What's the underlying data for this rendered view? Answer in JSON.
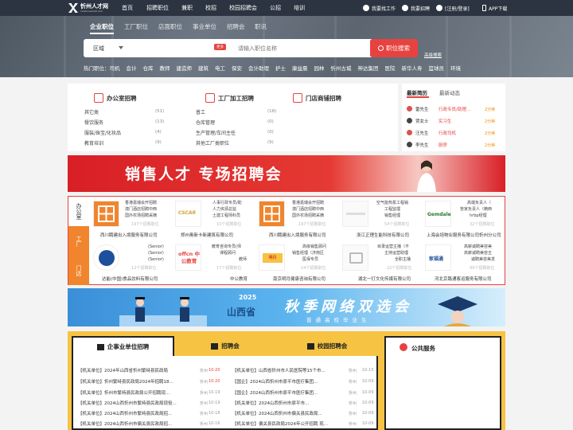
{
  "site": {
    "logo_text": "忻州人才网",
    "logo_sub": "xinzhourencai.com"
  },
  "topnav": [
    "首页",
    "招聘职位",
    "兼职",
    "校招",
    "校园招聘会",
    "公招",
    "培训"
  ],
  "topright": {
    "find_job": "我要找工作",
    "hire": "我要招聘",
    "login": "[注册/登录]",
    "app": "APP下载"
  },
  "search": {
    "tabs": [
      "企业职位",
      "工厂职位",
      "店面职位",
      "事业单位",
      "招聘会",
      "职讯"
    ],
    "area": "区域",
    "more": "更多",
    "placeholder": "请输入职位名称",
    "button": "职位搜索",
    "advanced": "高级搜索"
  },
  "hot": {
    "label": "热门职位：司机",
    "items": [
      "会计",
      "仓库",
      "教师",
      "建造师",
      "建筑",
      "电工",
      "保安",
      "会计助理",
      "护士",
      "康益晨",
      "园林",
      "忻州古城",
      "神达集团",
      "医院",
      "新华人寿",
      "篮球员",
      "环境"
    ]
  },
  "categories": [
    {
      "title": "办公室招聘",
      "rows": [
        [
          "其它类",
          "(51)"
        ],
        [
          "餐饮服务",
          "(13)"
        ],
        [
          "服装/珠宝/化妆品",
          "(4)"
        ],
        [
          "教育培训",
          "(9)"
        ]
      ]
    },
    {
      "title": "工厂加工招聘",
      "rows": [
        [
          "普工",
          "(18)"
        ],
        [
          "仓库管理",
          "(0)"
        ],
        [
          "生产管理/车间主任",
          "(0)"
        ],
        [
          "其他工厂类职位",
          "(9)"
        ]
      ]
    },
    {
      "title": "门店商铺招聘",
      "rows": []
    }
  ],
  "latest": {
    "tabs": [
      "最新简历",
      "最新动态"
    ],
    "items": [
      {
        "name": "雷先生",
        "job": "行政专员/助理...",
        "time": "2分钟"
      },
      {
        "name": "贾女士",
        "job": "实习生",
        "time": "2分钟"
      },
      {
        "name": "汪先生",
        "job": "行政司机",
        "time": "2分钟"
      },
      {
        "name": "李先生",
        "job": "厨房",
        "time": "2分钟"
      }
    ]
  },
  "banner1": {
    "text": "销售人才  专场招聘会"
  },
  "ent_tabs": [
    "办公室",
    "工厂",
    "门店"
  ],
  "companies": [
    {
      "lines": [
        "香港嘉瑞会开招聘",
        "澳门酒店招聘中西",
        "国外农场招聘采摘"
      ],
      "count": "197个招聘职位",
      "name": "西川聘建出入境服务有限公司"
    },
    {
      "lines": [
        "人事行政专员/助",
        "人力资源总监",
        "土建工程师科员"
      ],
      "count": "10个招聘职位",
      "name": "郑州奥新卡新建筑有限公司"
    },
    {
      "lines": [
        "香港嘉瑞会开招聘",
        "澳门酒店招聘中西",
        "国外农场招聘采摘"
      ],
      "count": "197个招聘职位",
      "name": "西川聘建出入境服务有限公司"
    },
    {
      "lines": [
        "空气能热泵工程销",
        "工程监理",
        "销售经理"
      ],
      "count": "54个招聘职位",
      "name": "浙江正理生能科技有限公司"
    },
    {
      "lines": [
        "高端负责人（",
        "管家负责人（精西",
        "hrbp经理"
      ],
      "count": "32个招聘职位",
      "name": "上海会培物业服务有限公司忻州分公司"
    },
    {
      "lines": [
        "(Senior)",
        "(Senior)",
        "(Senior)"
      ],
      "count": "12个招聘职位",
      "name": "达能(中国)食品饮料有限公司"
    },
    {
      "lines": [
        "教育咨询专员(师",
        "课程顾问",
        "教师"
      ],
      "count": "17个招聘职位",
      "name": "中公教育"
    },
    {
      "lines": [
        "高级销售顾问",
        "销售经理（济南区",
        "医保专员"
      ],
      "count": "14个招聘职位",
      "name": "南京明月健康咨询有限公司"
    },
    {
      "lines": [
        "目录运营主播（不",
        "主持运营助理",
        "全职主播"
      ],
      "count": "22个招聘职位",
      "name": "湖北一打文化传媒有限公司"
    },
    {
      "lines": [
        "高薪诚聘美容美",
        "高薪诚聘美容五",
        "诚聘美容美发"
      ],
      "count": "99个招聘职位",
      "name": "河北京路通客运服务有限公司"
    }
  ],
  "logo_texts": [
    "Gemdale",
    "offcn 中公教育",
    "明月",
    "家福通",
    "CSCAR"
  ],
  "banner2": {
    "year": "2025",
    "province": "山西省",
    "title": "秋季网络双选会",
    "sub": "普通高校毕业生"
  },
  "ytabs": [
    "企事业单位招聘",
    "招聘会",
    "校园招聘会"
  ],
  "service": {
    "title": "公共服务"
  },
  "left_list": [
    {
      "t": "【机关单位】2024年山西省忻州繁峙县民政局",
      "loc": "忻州",
      "d": "10-20",
      "red": true
    },
    {
      "t": "【机关单位】忻州繁峙县民政局2024年招聘18...",
      "loc": "忻州",
      "d": "10-20",
      "red": true
    },
    {
      "t": "【机关单位】忻州市繁峙县民政局公开招聘现...",
      "loc": "忻州",
      "d": "10-19",
      "red": false
    },
    {
      "t": "【机关单位】2024山西忻州市繁峙县民政局现役...",
      "loc": "忻州",
      "d": "10-19",
      "red": false
    },
    {
      "t": "【机关单位】2024山西忻州市繁峙县民政局招...",
      "loc": "忻州",
      "d": "10-18",
      "red": false
    },
    {
      "t": "【机关单位】2024山西忻州市偏关县民政局招...",
      "loc": "忻州",
      "d": "10-16",
      "red": false
    }
  ],
  "right_list": [
    {
      "t": "【机关单位】山西省忻州市人民医院等15个市...",
      "loc": "忻州",
      "d": "10-15"
    },
    {
      "t": "【国企】2024山西忻州市原平市医疗集团...",
      "loc": "忻州",
      "d": "10-09"
    },
    {
      "t": "【国企】2024山西忻州市原平市医疗集团...",
      "loc": "忻州",
      "d": "10-09"
    },
    {
      "t": "【机关单位】2024山西忻州市原平市...",
      "loc": "忻州",
      "d": "10-09"
    },
    {
      "t": "【机关单位】2024山西忻州市偏关县民政局...",
      "loc": "忻州",
      "d": "10-09"
    },
    {
      "t": "【机关单位】偏关县民政局2024年公开招聘 现...",
      "loc": "忻州",
      "d": "10-09"
    }
  ]
}
